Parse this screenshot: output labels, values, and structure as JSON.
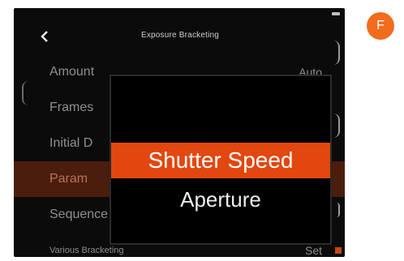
{
  "header": {
    "title": "Exposure Bracketing",
    "back_icon": "chevron-left-icon"
  },
  "menu": {
    "items": [
      {
        "label": "Amount",
        "value": "Auto"
      },
      {
        "label": "Frames",
        "value": ""
      },
      {
        "label": "Initial D",
        "value": ""
      },
      {
        "label": "Param",
        "value": ""
      },
      {
        "label": "Sequence",
        "value": ""
      },
      {
        "label": "Various Bracketing",
        "value": "Set"
      }
    ]
  },
  "popup": {
    "options": [
      {
        "label": "Shutter Speed",
        "selected": true
      },
      {
        "label": "Aperture",
        "selected": false
      }
    ]
  },
  "avatar": {
    "letter": "F",
    "color": "#f26c1e"
  },
  "colors": {
    "accent": "#e2470f",
    "selected_row": "#4a1d0c",
    "screen_bg": "#0b0b0b"
  }
}
